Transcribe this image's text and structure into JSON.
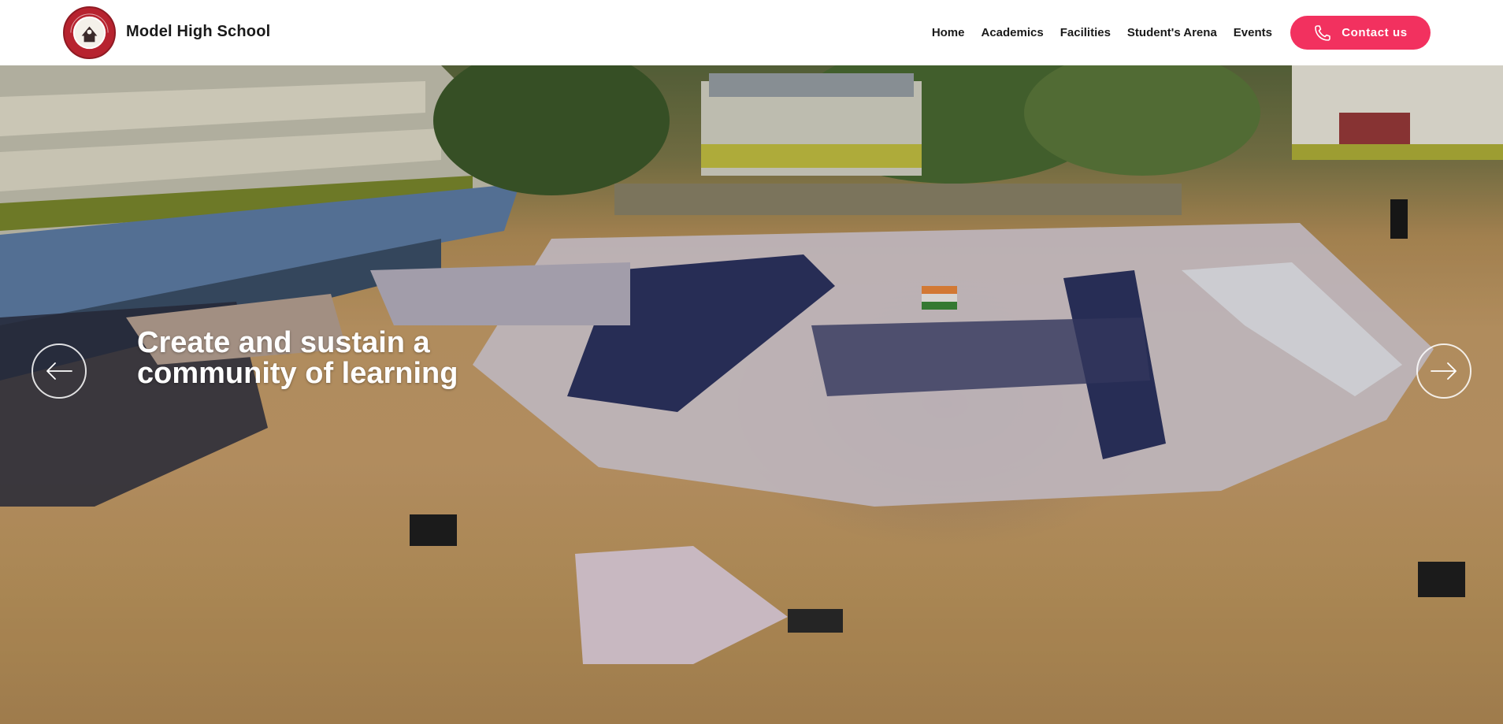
{
  "brand": {
    "name": "Model High School",
    "logo_icon": "school-crest-icon",
    "logo_text": "MODEL HIGH SCHOOL PERUMPADAVA"
  },
  "nav": {
    "items": [
      {
        "label": "Home"
      },
      {
        "label": "Academics"
      },
      {
        "label": "Facilities"
      },
      {
        "label": "Student's Arena"
      },
      {
        "label": "Events"
      }
    ],
    "contact": {
      "label": "Contact us",
      "icon": "phone-icon"
    }
  },
  "hero": {
    "headline": "Create and sustain a community of learning",
    "prev_icon": "arrow-left-icon",
    "next_icon": "arrow-right-icon"
  },
  "colors": {
    "accent": "#f2315f",
    "logo_red": "#b7232f",
    "text_dark": "#1a1a1a"
  }
}
